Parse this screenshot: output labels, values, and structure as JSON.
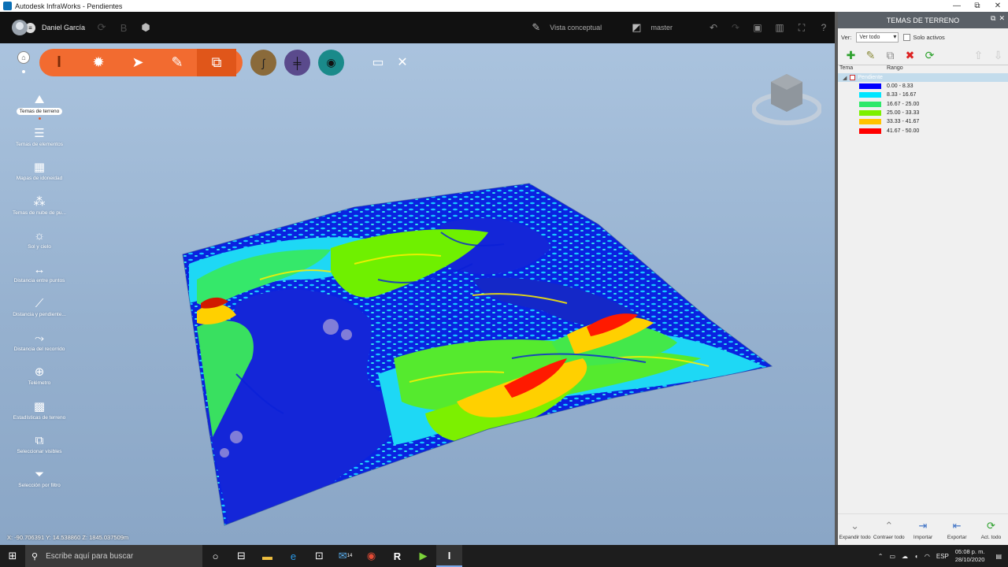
{
  "window": {
    "title": "Autodesk InfraWorks - Pendientes",
    "min": "—",
    "restore": "⧉",
    "close": "✕"
  },
  "appbar": {
    "user": "Daniel García",
    "mode_label": "Vista conceptual",
    "branch_label": "master"
  },
  "toolbar": {
    "icons": [
      "infraworks-icon",
      "build-icon",
      "select-icon",
      "sketch-icon",
      "layers-icon"
    ],
    "circle_colors": [
      "#8a6a3a",
      "#5a4a8c",
      "#1a8a8a"
    ]
  },
  "left_tools": [
    {
      "label": "Temas de terreno",
      "icon": "mountain-icon",
      "selected": true
    },
    {
      "label": "Temas de elementos",
      "icon": "list-icon"
    },
    {
      "label": "Mapas de idoneidad",
      "icon": "map-icon"
    },
    {
      "label": "Temas de nube de pu...",
      "icon": "point-cloud-icon"
    },
    {
      "label": "Sol y cielo",
      "icon": "sun-icon"
    },
    {
      "label": "Distancia entre puntos",
      "icon": "distance-icon"
    },
    {
      "label": "Distancia y pendiente...",
      "icon": "slope-icon"
    },
    {
      "label": "Distancia del recorrido",
      "icon": "path-icon"
    },
    {
      "label": "Telémetro",
      "icon": "crosshair-icon"
    },
    {
      "label": "Estadísticas de terreno",
      "icon": "grid-icon"
    },
    {
      "label": "Seleccionar visibles",
      "icon": "select-visible-icon"
    },
    {
      "label": "Selección por filtro",
      "icon": "filter-icon"
    }
  ],
  "coords": "X: -90.706391 Y: 14.538860 Z: 1845.037509m",
  "panel": {
    "title": "TEMAS DE TERRENO",
    "view_label": "Ver:",
    "view_value": "Ver todo",
    "only_active": "Solo activos",
    "col_theme": "Tema",
    "col_range": "Rango",
    "theme_name": "Pendiente",
    "legend": [
      {
        "range": "0.00 - 8.33",
        "color": "#0000ff"
      },
      {
        "range": "8.33 - 16.67",
        "color": "#00e5ff"
      },
      {
        "range": "16.67 - 25.00",
        "color": "#2ee86a"
      },
      {
        "range": "25.00 - 33.33",
        "color": "#7cf000"
      },
      {
        "range": "33.33 - 41.67",
        "color": "#ffc400"
      },
      {
        "range": "41.67 - 50.00",
        "color": "#ff0000"
      }
    ],
    "footer": [
      "Expandir todo",
      "Contraer todo",
      "Importar",
      "Exportar",
      "Act. todo"
    ]
  },
  "taskbar": {
    "search_placeholder": "Escribe aquí para buscar",
    "lang": "ESP",
    "time": "05:08 p. m.",
    "date": "28/10/2020",
    "mail_badge": "14"
  }
}
